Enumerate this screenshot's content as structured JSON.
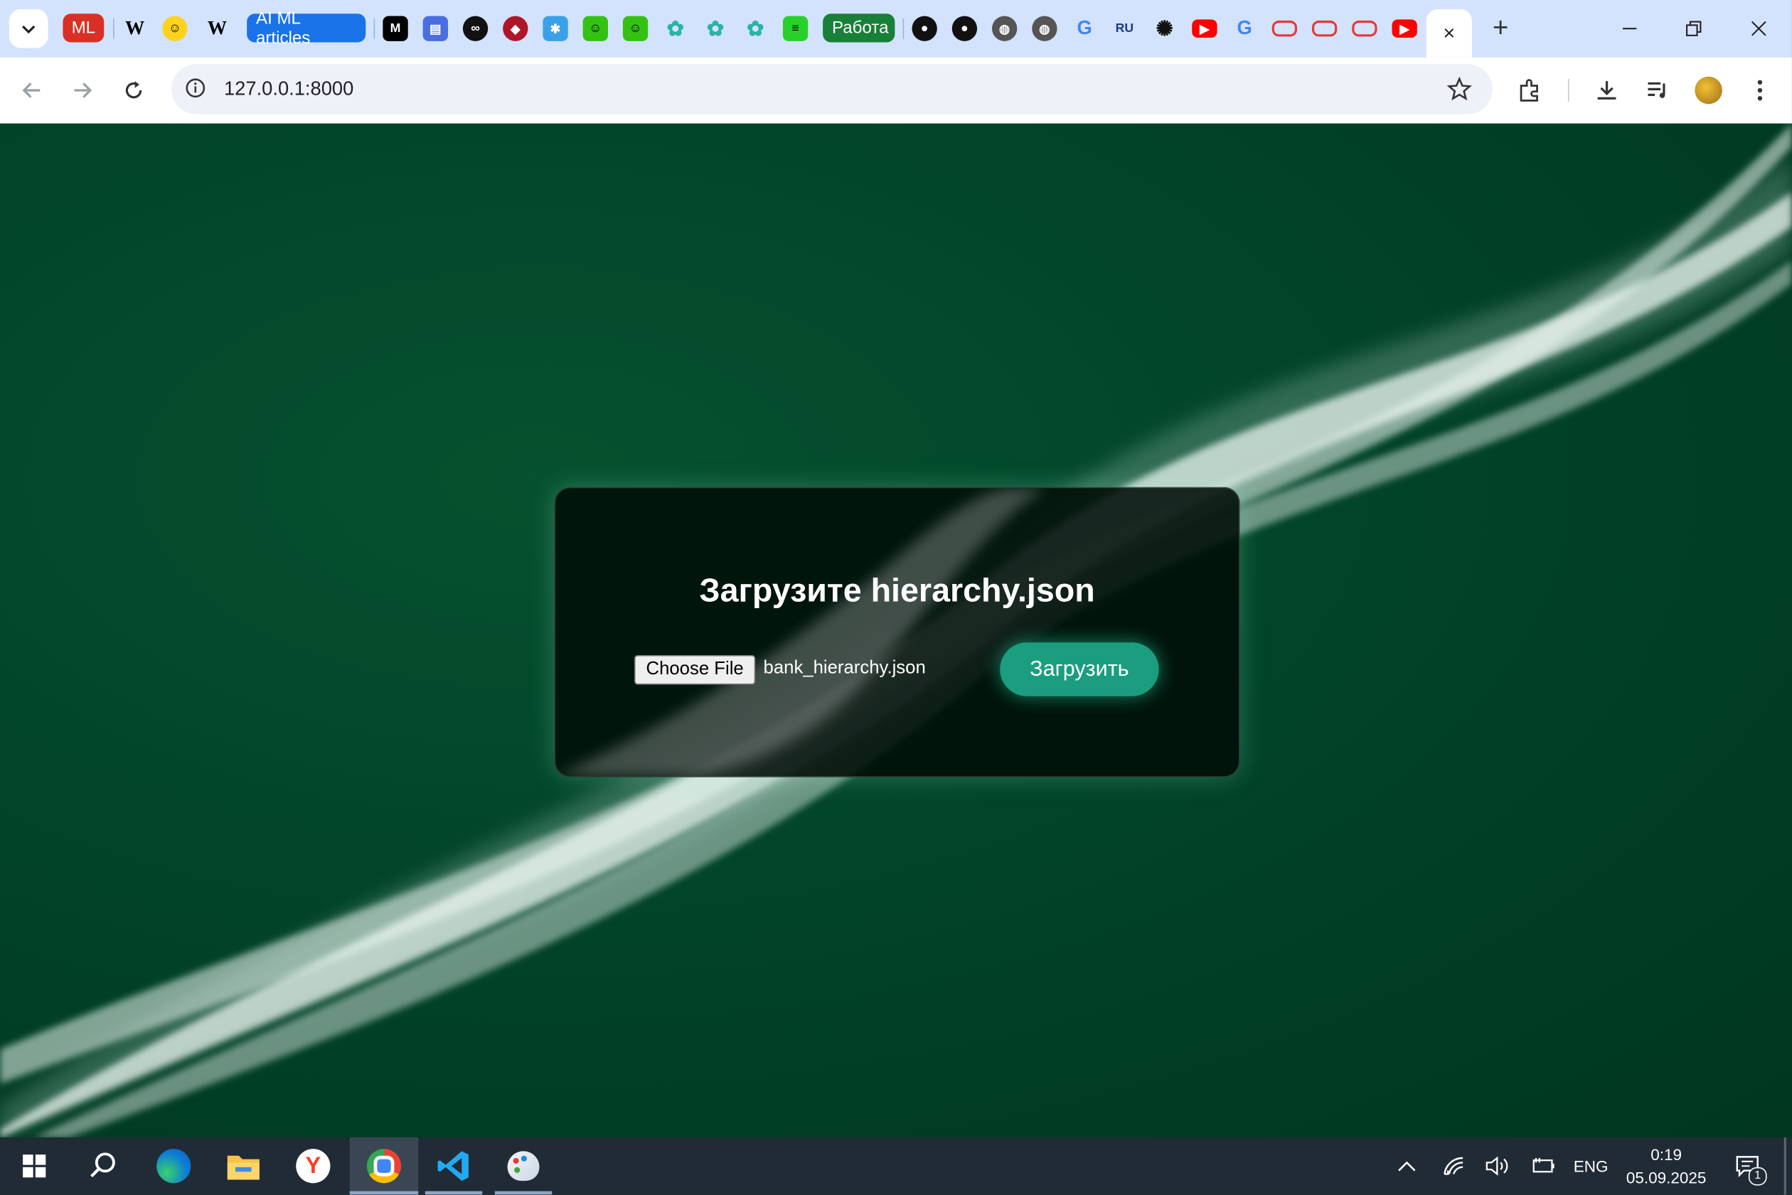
{
  "browser": {
    "tab_groups": [
      {
        "label": "ML",
        "color": "#d93025"
      },
      {
        "label": "AI ML articles",
        "color": "#1a73e8"
      },
      {
        "label": "Работа",
        "color": "#188038"
      }
    ],
    "pinned_icons": [
      "wikipedia-icon",
      "huggingface-icon",
      "wikipedia-icon",
      "medium-icon",
      "clipboard-icon",
      "infinity-icon",
      "eye-icon",
      "snowflake-icon",
      "smiley-icon",
      "smiley-icon",
      "colab-icon",
      "colab-icon",
      "colab-icon",
      "terminal-icon",
      "github-icon",
      "github-icon",
      "globe-icon",
      "globe-icon",
      "google-icon",
      "ru-icon",
      "openai-icon",
      "youtube-icon",
      "google-icon",
      "oval-icon",
      "oval-icon",
      "oval-icon",
      "youtube-icon"
    ],
    "active_tab": {
      "close_icon": "×"
    },
    "new_tab": "+",
    "address": "127.0.0.1:8000"
  },
  "page": {
    "title": "Загрузите hierarchy.json",
    "file_button": "Choose File",
    "file_name": "bank_hierarchy.json",
    "upload_button": "Загрузить"
  },
  "taskbar": {
    "apps": [
      "start-icon",
      "search-icon",
      "edge-icon",
      "file-explorer-icon",
      "yandex-icon",
      "chrome-icon",
      "vscode-icon",
      "paint-icon"
    ],
    "language": "ENG",
    "time": "0:19",
    "date": "05.09.2025",
    "notifications": "1"
  },
  "colors": {
    "accent": "#1a9e7f",
    "background": "#014429",
    "tabstrip": "#d3e3fd"
  }
}
